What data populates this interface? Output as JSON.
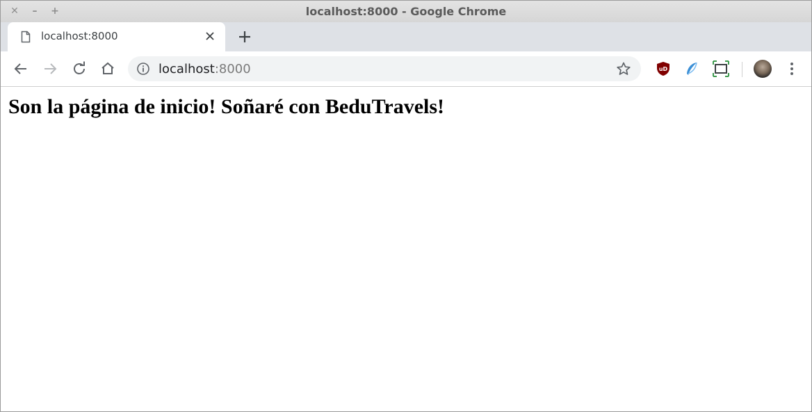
{
  "window": {
    "title": "localhost:8000 - Google Chrome"
  },
  "tab": {
    "title": "localhost:8000"
  },
  "address_bar": {
    "host": "localhost",
    "port": ":8000"
  },
  "page": {
    "heading": "Son la página de inicio! Soñaré con BeduTravels!"
  },
  "icons": {
    "favicon": "page-icon",
    "extension1": "ublock-icon",
    "extension2": "feather-icon",
    "extension3": "screenshot-icon"
  },
  "colors": {
    "ublock_red": "#800000",
    "feather_blue": "#3b8fd6",
    "screenshot_green": "#3d9a4e"
  }
}
